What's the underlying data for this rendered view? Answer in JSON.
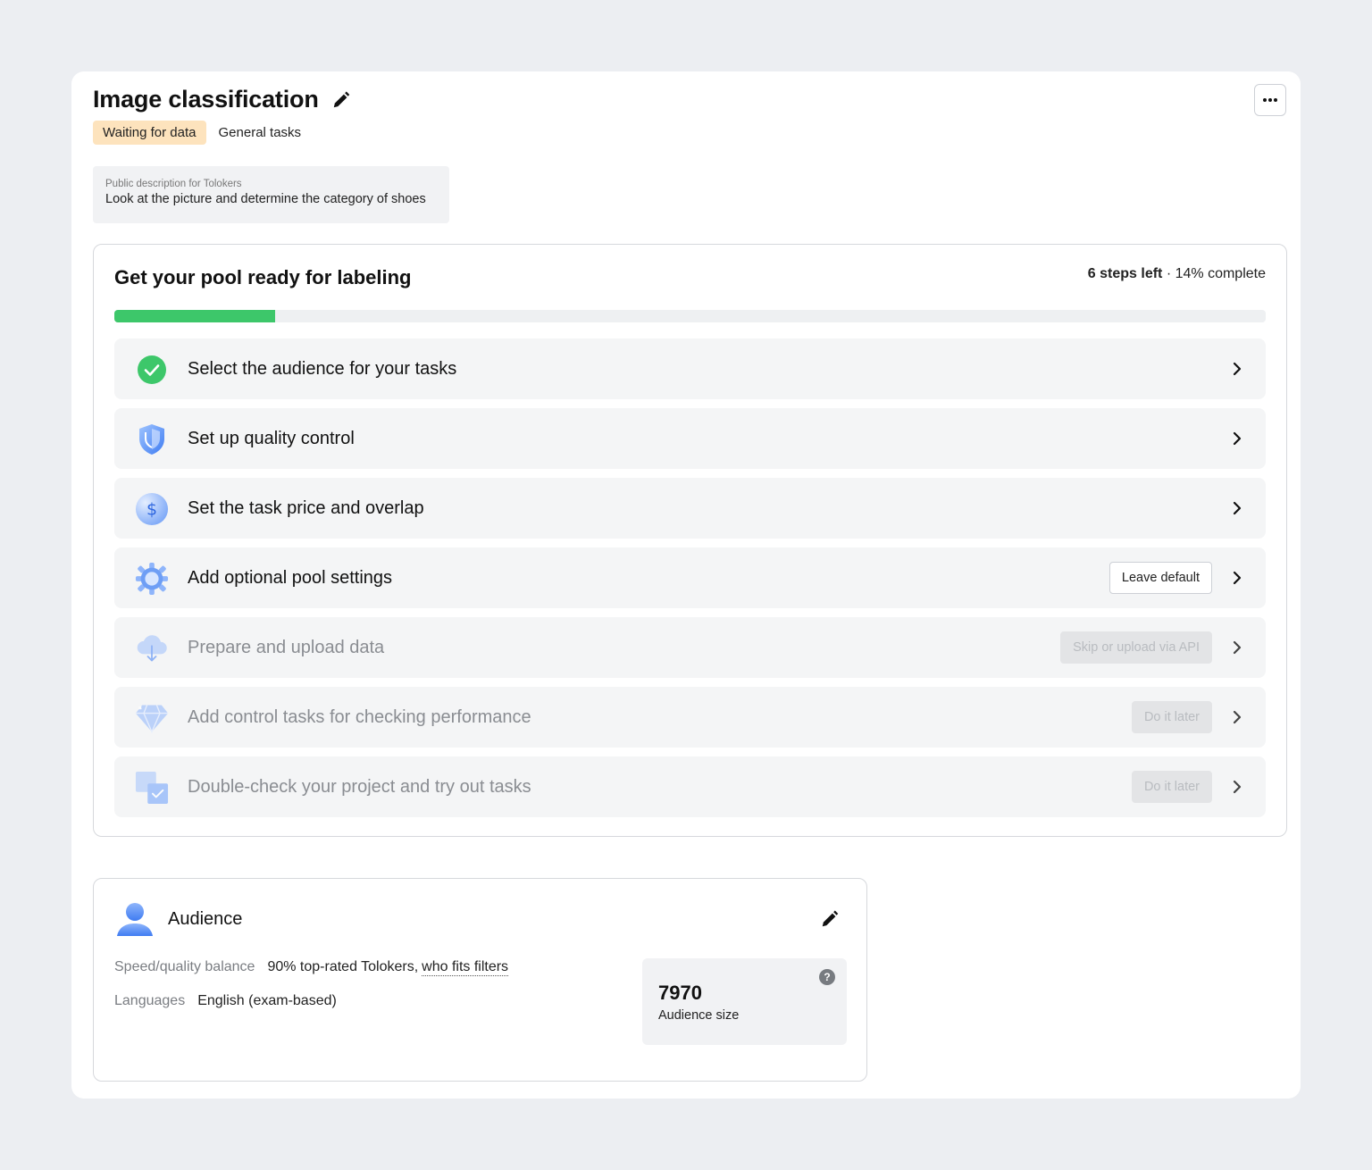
{
  "header": {
    "title": "Image classification",
    "status_tag": "Waiting for data",
    "category_tag": "General tasks"
  },
  "description": {
    "label": "Public description for Tolokers",
    "text": "Look at the picture and determine the category of shoes"
  },
  "pool": {
    "title": "Get your pool ready for labeling",
    "steps_left": "6 steps left",
    "separator": " · ",
    "complete": "14% complete",
    "progress_percent": 14,
    "accent_color": "#3dc76a",
    "steps": [
      {
        "label": "Select the audience for your tasks",
        "icon": "check-circle-icon",
        "state": "done",
        "action": ""
      },
      {
        "label": "Set up quality control",
        "icon": "shield-icon",
        "state": "active",
        "action": ""
      },
      {
        "label": "Set the task price and overlap",
        "icon": "dollar-coin-icon",
        "state": "active",
        "action": ""
      },
      {
        "label": "Add optional pool settings",
        "icon": "gear-icon",
        "state": "active",
        "action": "Leave default"
      },
      {
        "label": "Prepare and upload data",
        "icon": "cloud-download-icon",
        "state": "disabled",
        "action": "Skip or upload via API"
      },
      {
        "label": "Add control tasks for checking performance",
        "icon": "diamond-icon",
        "state": "disabled",
        "action": "Do it later"
      },
      {
        "label": "Double-check your project and try out tasks",
        "icon": "checkbox-stack-icon",
        "state": "disabled",
        "action": "Do it later"
      }
    ]
  },
  "audience": {
    "title": "Audience",
    "speed_label": "Speed/quality balance",
    "speed_value": "90% top-rated Tolokers,",
    "speed_link": "who fits filters",
    "languages_label": "Languages",
    "languages_value": "English (exam-based)",
    "size_value": "7970",
    "size_label": "Audience size",
    "help_glyph": "?"
  }
}
